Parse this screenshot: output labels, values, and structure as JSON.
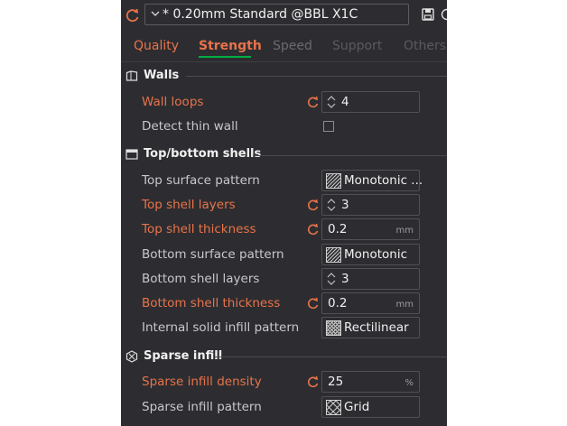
{
  "header": {
    "preset_name": "* 0.20mm Standard @BBL X1C"
  },
  "tabs": [
    "Quality",
    "Strength",
    "Speed",
    "Support",
    "Others"
  ],
  "sections": {
    "walls": {
      "title": "Walls",
      "rows": [
        {
          "label": "Wall loops",
          "value": "4"
        },
        {
          "label": "Detect thin wall",
          "checked": false
        }
      ]
    },
    "top_bottom": {
      "title": "Top/bottom shells",
      "rows": [
        {
          "label": "Top surface pattern",
          "value": "Monotonic ..."
        },
        {
          "label": "Top shell layers",
          "value": "3"
        },
        {
          "label": "Top shell thickness",
          "value": "0.2",
          "unit": "mm"
        },
        {
          "label": "Bottom surface pattern",
          "value": "Monotonic"
        },
        {
          "label": "Bottom shell layers",
          "value": "3"
        },
        {
          "label": "Bottom shell thickness",
          "value": "0.2",
          "unit": "mm"
        },
        {
          "label": "Internal solid infill pattern",
          "value": "Rectilinear"
        }
      ]
    },
    "sparse": {
      "title": "Sparse infill",
      "rows": [
        {
          "label": "Sparse infill density",
          "value": "25",
          "unit": "%"
        },
        {
          "label": "Sparse infill pattern",
          "value": "Grid"
        }
      ]
    }
  },
  "colors": {
    "panel_bg": "#2d2d31",
    "modified_label": "#e8734a",
    "active_tab_underline": "#00ae42",
    "text": "#c8c8cc"
  }
}
